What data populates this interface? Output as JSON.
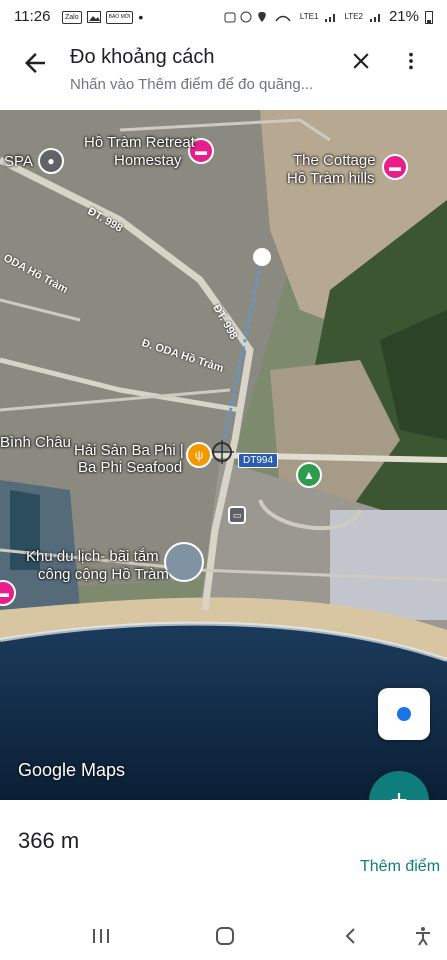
{
  "status_bar": {
    "time": "11:26",
    "left_icons": [
      "zalo",
      "gallery",
      "bao-moi",
      "dot"
    ],
    "zalo_label": "Zalo",
    "bao_label": "BÁO MỚI",
    "battery": "21%",
    "signal1": "LTE1",
    "signal2": "LTE2"
  },
  "header": {
    "title": "Đo khoảng cách",
    "subtitle": "Nhấn vào Thêm điểm để đo quãng..."
  },
  "map": {
    "labels": {
      "spa": "SPA",
      "retreat_1": "Hồ Tràm Retreat",
      "retreat_2": "Homestay",
      "cottage_1": "The Cottage",
      "cottage_2": "Hồ Tràm hills",
      "seafood_1": "Hải Sản Ba Phi |",
      "seafood_2": "Ba Phi Seafood",
      "beach_1": "Khu du lịch- bãi tắm",
      "beach_2": "công cộng Hồ Tràm",
      "binh_chau": "Bình Châu"
    },
    "roads": {
      "dt998_a": "ĐT. 998",
      "dt998_b": "ĐT. 998",
      "oda_1": "ODA Hồ Tràm",
      "oda_2": "Đ. ODA Hồ Tràm",
      "shield": "DT994"
    },
    "attribution": "Google Maps"
  },
  "measure": {
    "distance": "366 m",
    "add_point_label": "Thêm điểm"
  },
  "colors": {
    "accent": "#0e7d7c",
    "measure_line": "#4a9df0",
    "location_dot": "#1a73e8",
    "hotel_pin": "#e91e8c",
    "food_pin": "#f29900",
    "park_pin": "#2e9b4f"
  }
}
